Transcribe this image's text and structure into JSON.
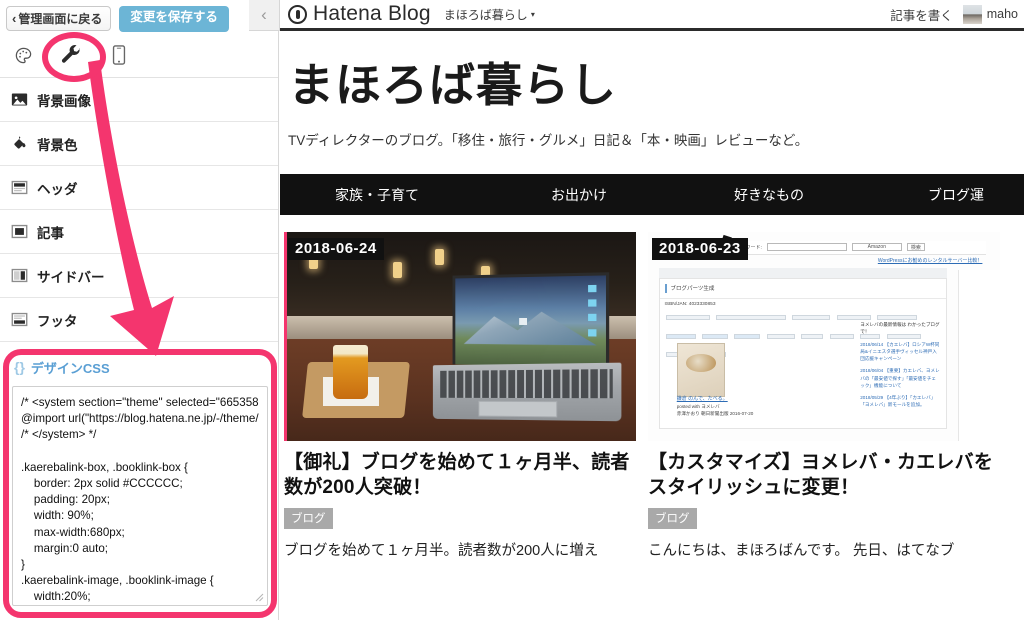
{
  "sidebar": {
    "back_button": "管理画面に戻る",
    "back_chevron": "‹",
    "save_button": "変更を保存する",
    "tabs": [
      {
        "name": "palette-icon",
        "title": "デザイン"
      },
      {
        "name": "wrench-icon",
        "title": "カスタマイズ"
      },
      {
        "name": "smartphone-icon",
        "title": "スマートフォン"
      }
    ],
    "menu": [
      {
        "icon": "image-icon",
        "label": "背景画像"
      },
      {
        "icon": "paint-bucket-icon",
        "label": "背景色"
      },
      {
        "icon": "header-layout-icon",
        "label": "ヘッダ"
      },
      {
        "icon": "article-layout-icon",
        "label": "記事"
      },
      {
        "icon": "sidebar-layout-icon",
        "label": "サイドバー"
      },
      {
        "icon": "footer-layout-icon",
        "label": "フッタ"
      }
    ],
    "css_panel": {
      "brace_icon": "{}",
      "title": "デザインCSS",
      "code": "/* <system section=\"theme\" selected=\"665358\n@import url(\"https://blog.hatena.ne.jp/-/theme/\n/* </system> */\n\n.kaerebalink-box, .booklink-box {\n    border: 2px solid #CCCCCC;\n    padding: 20px;\n    width: 90%;\n    max-width:680px;\n    margin:0 auto;\n}\n.kaerebalink-image, .booklink-image {\n    width:20%;\n    float: left;\n}\n}"
    }
  },
  "collapse_button": "‹",
  "preview": {
    "globalbar": {
      "brand": "Hatena Blog",
      "blog_selector": "まほろば暮らし",
      "caret": "▾",
      "write_entry": "記事を書く",
      "user": "maho"
    },
    "blog": {
      "title": "まほろば暮らし",
      "description": "TVディレクターのブログ。「移住・旅行・グルメ」日記＆「本・映画」レビューなど。",
      "nav": [
        "家族・子育て",
        "お出かけ",
        "好きなもの",
        "ブログ運"
      ]
    },
    "entries": [
      {
        "date": "2018-06-24",
        "title": "【御礼】ブログを始めて１ヶ月半、読者数が200人突破！",
        "category": "ブログ",
        "excerpt": "ブログを始めて１ヶ月半。読者数が200人に増え"
      },
      {
        "date": "2018-06-23",
        "title": "【カスタマイズ】ヨメレバ・カエレバをスタイリッシュに変更！",
        "category": "ブログ",
        "excerpt": "こんにちは、まほろばんです。 先日、はてなブ",
        "screenshot": {
          "search_label": "書籍キーワード:",
          "store": "Amazon",
          "search_btn": "検索",
          "promo_link": "WordPressにお勧めのレンタルサーバー比較！",
          "panel_title": "ブログパーツ生成",
          "isbn_label": "ISBN/JAN: 4023330853",
          "size_opts": [
            "画像小",
            "100%",
            "表示"
          ],
          "stores": [
            "Amazon",
            "Kindle",
            "楽天市場",
            "楽天kobo",
            "7net",
            "honto",
            "ehon",
            "紀伊國屋書店",
            "ebookjapan",
            "図書館"
          ],
          "book_caption": "鎌倉 のんで、たべる。",
          "posted_with": "posted with ヨメレバ",
          "book_meta": "赤澤かおり 朝日新聞出版 2016-07-20",
          "side_title": "ヨメレバの最新情報は わかったブログで！",
          "side_items": [
            "2018/06/14 【カエレバ】ロシアW杯同局&イニエスタ選手ヴィッセル神戸入団応援キャンペーン",
            "2018/06/04 【重要】カエレバ、ヨメレバの「最安値で探す」「最安値をチェック」機能について",
            "2018/05/29 【4年ぶり】「カエレバ」「ヨメレバ」新モールを追加。"
          ]
        }
      }
    ]
  },
  "colors": {
    "accent_pink": "#f4356e",
    "save_blue": "#6cb5d6",
    "nav_black": "#111111",
    "css_title_blue": "#5a9fd4"
  }
}
